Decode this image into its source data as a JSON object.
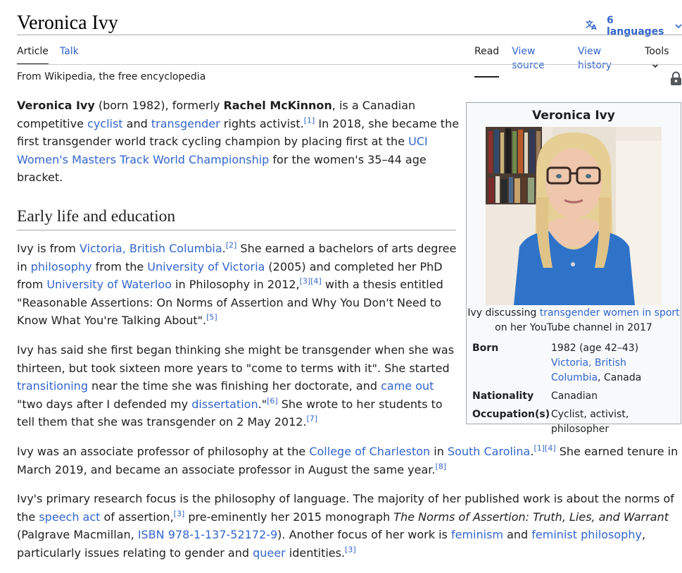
{
  "page": {
    "title": "Veronica Ivy",
    "languages_label": "6 languages",
    "tabs_left": [
      "Article",
      "Talk"
    ],
    "tabs_right": [
      "Read",
      "View source",
      "View history",
      "Tools"
    ],
    "from_line": "From Wikipedia, the free encyclopedia"
  },
  "lead": {
    "name_bold": "Veronica Ivy",
    "t1": " (born 1982), formerly ",
    "former_name": "Rachel McKinnon",
    "t2": ", is a Canadian competitive ",
    "link_cyclist": "cyclist",
    "t3": " and ",
    "link_transgender": "transgender",
    "t4": " rights activist.",
    "ref1": "[1]",
    "t5": " In 2018, she became the first transgender world track cycling champion by placing first at the ",
    "link_uci": "UCI Women's Masters Track World Championship",
    "t6": " for the women's 35–44 age bracket."
  },
  "section": {
    "heading": "Early life and education"
  },
  "p1": {
    "t1": "Ivy is from ",
    "link_victoria": "Victoria, British Columbia",
    "t2": ".",
    "ref2": "[2]",
    "t3": " She earned a bachelors of arts degree in ",
    "link_philosophy": "philosophy",
    "t4": " from the ",
    "link_uvic": "University of Victoria",
    "t5": " (2005) and completed her PhD from ",
    "link_waterloo": "University of Waterloo",
    "t6": " in Philosophy in 2012,",
    "ref3": "[3]",
    "ref4": "[4]",
    "t7": " with a thesis entitled \"Reasonable Assertions: On Norms of Assertion and Why You Don't Need to Know What You're Talking About\".",
    "ref5": "[5]"
  },
  "p2": {
    "t1": "Ivy has said she first began thinking she might be transgender when she was thirteen, but took sixteen more years to \"come to terms with it\". She started ",
    "link_transitioning": "transitioning",
    "t2": " near the time she was finishing her doctorate, and ",
    "link_cameout": "came out",
    "t3": " \"two days after I defended my ",
    "link_dissertation": "dissertation",
    "t4": ".\"",
    "ref6": "[6]",
    "t5": " She wrote to her students to tell them that she was transgender on 2 May 2012.",
    "ref7": "[7]"
  },
  "p3": {
    "t1": "Ivy was an associate professor of philosophy at the ",
    "link_charleston": "College of Charleston",
    "t2": " in ",
    "link_sc": "South Carolina",
    "t3": ".",
    "ref1": "[1]",
    "ref4": "[4]",
    "t4": " She earned tenure in March 2019, and became an associate professor in August the same year.",
    "ref8": "[8]"
  },
  "p4": {
    "t1": "Ivy's primary research focus is the philosophy of language. The majority of her published work is about the norms of the ",
    "link_speech": "speech act",
    "t2": " of assertion,",
    "ref3": "[3]",
    "t3": " pre-eminently her 2015 monograph ",
    "book": "The Norms of Assertion: Truth, Lies, and Warrant",
    "t4": " (Palgrave Macmillan, ",
    "link_isbn": "ISBN 978-1-137-52172-9",
    "t5": "). Another focus of her work is ",
    "link_feminism": "feminism",
    "t6": " and ",
    "link_feminist_phil": "feminist philosophy",
    "t7": ", particularly issues relating to gender and ",
    "link_queer": "queer",
    "t8": " identities.",
    "ref3b": "[3]"
  },
  "infobox": {
    "title": "Veronica Ivy",
    "caption_t1": "Ivy discussing ",
    "caption_link": "transgender women in sport",
    "caption_t2": " on her YouTube channel in 2017",
    "born_label": "Born",
    "born_value": "1982 (age 42–43)",
    "born_place_link": "Victoria, British Columbia",
    "born_country": ", Canada",
    "nationality_label": "Nationality",
    "nationality_value": "Canadian",
    "occupation_label": "Occupation(s)",
    "occupation_value": "Cyclist, activist, philosopher"
  },
  "colors": {
    "link": "#3366cc",
    "text": "#202122",
    "rule": "#a2a9b1",
    "infobox_bg": "#f8f9fa"
  },
  "icons": [
    "translate-icon",
    "chevron-down-icon",
    "lock-icon"
  ]
}
